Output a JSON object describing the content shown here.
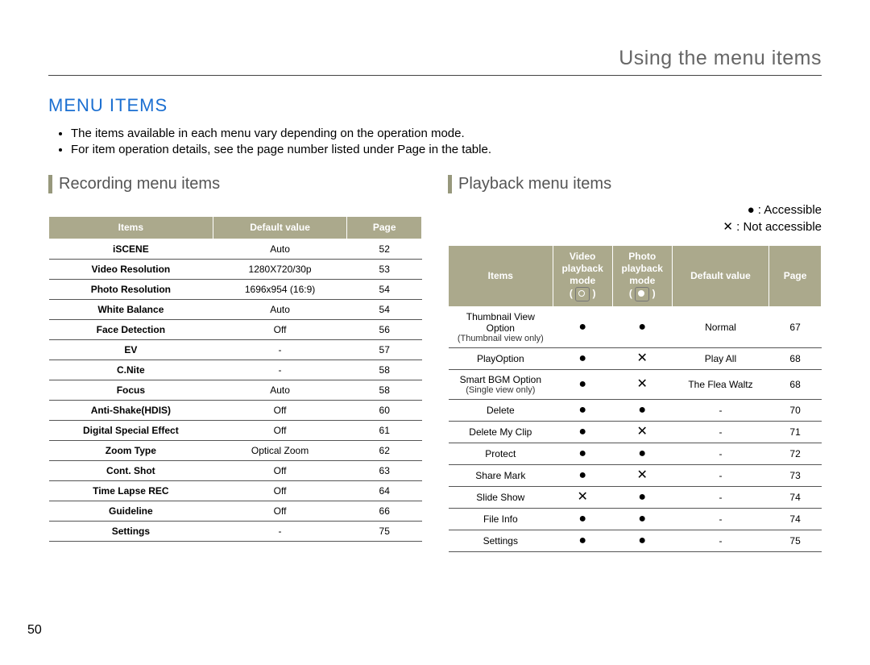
{
  "chapter": "Using the menu items",
  "section_title": "MENU ITEMS",
  "bullets": [
    "The items available in each menu vary depending on the operation mode.",
    "For item operation details, see the page number listed under Page in the table."
  ],
  "page_number": "50",
  "legend": {
    "accessible": "● : Accessible",
    "not_accessible": "✕ : Not accessible"
  },
  "recording": {
    "heading": "Recording menu items",
    "columns": [
      "Items",
      "Default value",
      "Page"
    ],
    "rows": [
      {
        "item": "iSCENE",
        "default": "Auto",
        "page": "52"
      },
      {
        "item": "Video Resolution",
        "default": "1280X720/30p",
        "page": "53"
      },
      {
        "item": "Photo Resolution",
        "default": "1696x954 (16:9)",
        "page": "54"
      },
      {
        "item": "White Balance",
        "default": "Auto",
        "page": "54"
      },
      {
        "item": "Face Detection",
        "default": "Off",
        "page": "56"
      },
      {
        "item": "EV",
        "default": "-",
        "page": "57"
      },
      {
        "item": "C.Nite",
        "default": "-",
        "page": "58"
      },
      {
        "item": "Focus",
        "default": "Auto",
        "page": "58"
      },
      {
        "item": "Anti-Shake(HDIS)",
        "default": "Off",
        "page": "60"
      },
      {
        "item": "Digital Special Effect",
        "default": "Off",
        "page": "61"
      },
      {
        "item": "Zoom Type",
        "default": "Optical Zoom",
        "page": "62"
      },
      {
        "item": "Cont. Shot",
        "default": "Off",
        "page": "63"
      },
      {
        "item": "Time Lapse REC",
        "default": "Off",
        "page": "64"
      },
      {
        "item": "Guideline",
        "default": "Off",
        "page": "66"
      },
      {
        "item": "Settings",
        "default": "-",
        "page": "75"
      }
    ]
  },
  "playback": {
    "heading": "Playback menu items",
    "columns": [
      "Items",
      "Video playback mode",
      "Photo playback mode",
      "Default value",
      "Page"
    ],
    "rows": [
      {
        "item": "Thumbnail View Option",
        "sub": "(Thumbnail view only)",
        "video": "●",
        "photo": "●",
        "default": "Normal",
        "page": "67"
      },
      {
        "item": "PlayOption",
        "sub": "",
        "video": "●",
        "photo": "✕",
        "default": "Play All",
        "page": "68"
      },
      {
        "item": "Smart BGM Option",
        "sub": "(Single view only)",
        "video": "●",
        "photo": "✕",
        "default": "The Flea Waltz",
        "page": "68"
      },
      {
        "item": "Delete",
        "sub": "",
        "video": "●",
        "photo": "●",
        "default": "-",
        "page": "70"
      },
      {
        "item": "Delete My Clip",
        "sub": "",
        "video": "●",
        "photo": "✕",
        "default": "-",
        "page": "71"
      },
      {
        "item": "Protect",
        "sub": "",
        "video": "●",
        "photo": "●",
        "default": "-",
        "page": "72"
      },
      {
        "item": "Share Mark",
        "sub": "",
        "video": "●",
        "photo": "✕",
        "default": "-",
        "page": "73"
      },
      {
        "item": "Slide Show",
        "sub": "",
        "video": "✕",
        "photo": "●",
        "default": "-",
        "page": "74"
      },
      {
        "item": "File Info",
        "sub": "",
        "video": "●",
        "photo": "●",
        "default": "-",
        "page": "74"
      },
      {
        "item": "Settings",
        "sub": "",
        "video": "●",
        "photo": "●",
        "default": "-",
        "page": "75"
      }
    ]
  }
}
